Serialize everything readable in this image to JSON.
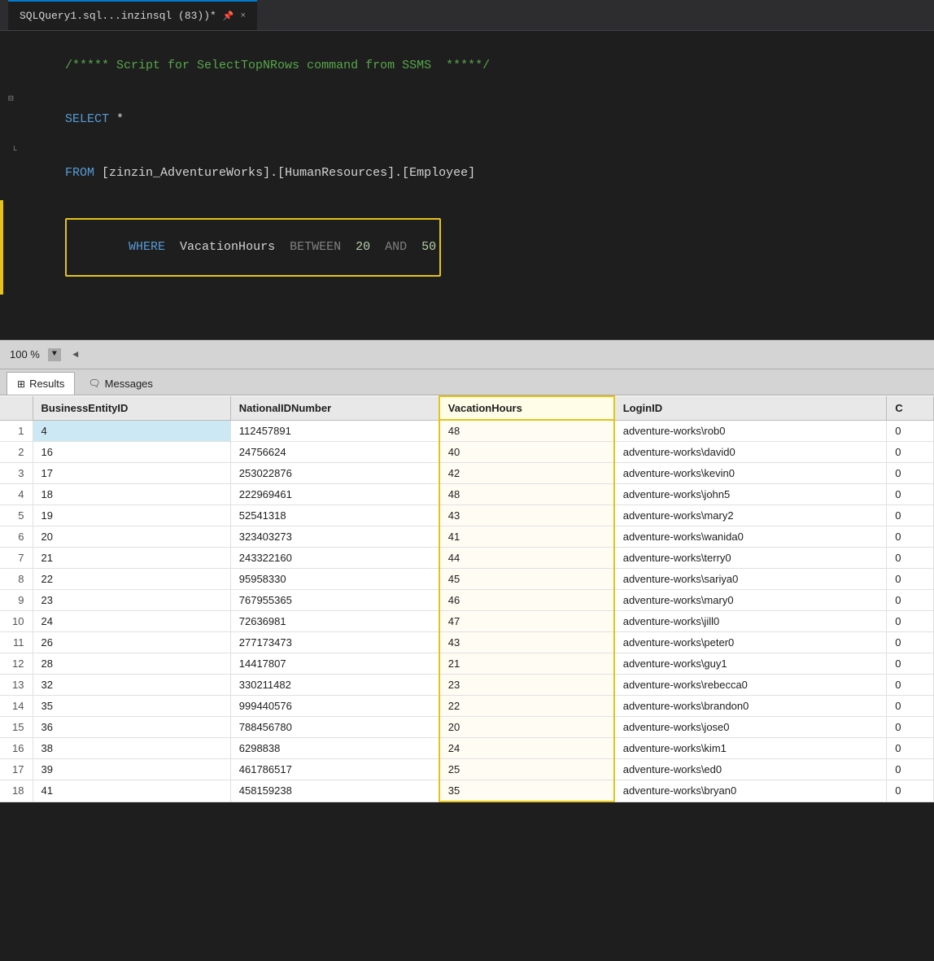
{
  "titlebar": {
    "tab_label": "SQLQuery1.sql...inzinsql (83))*",
    "pin_icon": "📌",
    "close_icon": "×"
  },
  "editor": {
    "comment_line": "/***** Script for SelectTopNRows command from SSMS  *****/",
    "select_line": "SELECT *",
    "from_line": "FROM [zinzin_AdventureWorks].[HumanResources].[Employee]",
    "where_line": "WHERE  VacationHours  BETWEEN  20  AND  50",
    "where_keyword": "WHERE",
    "where_col": "VacationHours",
    "where_between": "BETWEEN",
    "where_num1": "20",
    "where_and": "AND",
    "where_num2": "50"
  },
  "statusbar": {
    "zoom": "100 %",
    "scroll_arrow": "◄"
  },
  "results_tabs": [
    {
      "label": "Results",
      "icon": "⊞",
      "active": true
    },
    {
      "label": "Messages",
      "icon": "💬",
      "active": false
    }
  ],
  "table": {
    "columns": [
      {
        "key": "rownum",
        "label": ""
      },
      {
        "key": "BusinessEntityID",
        "label": "BusinessEntityID"
      },
      {
        "key": "NationalIDNumber",
        "label": "NationalIDNumber"
      },
      {
        "key": "VacationHours",
        "label": "VacationHours"
      },
      {
        "key": "LoginID",
        "label": "LoginID"
      },
      {
        "key": "C",
        "label": "C"
      }
    ],
    "rows": [
      {
        "rownum": "1",
        "BusinessEntityID": "4",
        "NationalIDNumber": "112457891",
        "VacationHours": "48",
        "LoginID": "adventure-works\\rob0",
        "C": "0",
        "selected": true
      },
      {
        "rownum": "2",
        "BusinessEntityID": "16",
        "NationalIDNumber": "24756624",
        "VacationHours": "40",
        "LoginID": "adventure-works\\david0",
        "C": "0"
      },
      {
        "rownum": "3",
        "BusinessEntityID": "17",
        "NationalIDNumber": "253022876",
        "VacationHours": "42",
        "LoginID": "adventure-works\\kevin0",
        "C": "0"
      },
      {
        "rownum": "4",
        "BusinessEntityID": "18",
        "NationalIDNumber": "222969461",
        "VacationHours": "48",
        "LoginID": "adventure-works\\john5",
        "C": "0"
      },
      {
        "rownum": "5",
        "BusinessEntityID": "19",
        "NationalIDNumber": "52541318",
        "VacationHours": "43",
        "LoginID": "adventure-works\\mary2",
        "C": "0"
      },
      {
        "rownum": "6",
        "BusinessEntityID": "20",
        "NationalIDNumber": "323403273",
        "VacationHours": "41",
        "LoginID": "adventure-works\\wanida0",
        "C": "0"
      },
      {
        "rownum": "7",
        "BusinessEntityID": "21",
        "NationalIDNumber": "243322160",
        "VacationHours": "44",
        "LoginID": "adventure-works\\terry0",
        "C": "0"
      },
      {
        "rownum": "8",
        "BusinessEntityID": "22",
        "NationalIDNumber": "95958330",
        "VacationHours": "45",
        "LoginID": "adventure-works\\sariya0",
        "C": "0"
      },
      {
        "rownum": "9",
        "BusinessEntityID": "23",
        "NationalIDNumber": "767955365",
        "VacationHours": "46",
        "LoginID": "adventure-works\\mary0",
        "C": "0"
      },
      {
        "rownum": "10",
        "BusinessEntityID": "24",
        "NationalIDNumber": "72636981",
        "VacationHours": "47",
        "LoginID": "adventure-works\\jill0",
        "C": "0"
      },
      {
        "rownum": "11",
        "BusinessEntityID": "26",
        "NationalIDNumber": "277173473",
        "VacationHours": "43",
        "LoginID": "adventure-works\\peter0",
        "C": "0"
      },
      {
        "rownum": "12",
        "BusinessEntityID": "28",
        "NationalIDNumber": "14417807",
        "VacationHours": "21",
        "LoginID": "adventure-works\\guy1",
        "C": "0"
      },
      {
        "rownum": "13",
        "BusinessEntityID": "32",
        "NationalIDNumber": "330211482",
        "VacationHours": "23",
        "LoginID": "adventure-works\\rebecca0",
        "C": "0"
      },
      {
        "rownum": "14",
        "BusinessEntityID": "35",
        "NationalIDNumber": "999440576",
        "VacationHours": "22",
        "LoginID": "adventure-works\\brandon0",
        "C": "0"
      },
      {
        "rownum": "15",
        "BusinessEntityID": "36",
        "NationalIDNumber": "788456780",
        "VacationHours": "20",
        "LoginID": "adventure-works\\jose0",
        "C": "0"
      },
      {
        "rownum": "16",
        "BusinessEntityID": "38",
        "NationalIDNumber": "6298838",
        "VacationHours": "24",
        "LoginID": "adventure-works\\kim1",
        "C": "0"
      },
      {
        "rownum": "17",
        "BusinessEntityID": "39",
        "NationalIDNumber": "461786517",
        "VacationHours": "25",
        "LoginID": "adventure-works\\ed0",
        "C": "0"
      },
      {
        "rownum": "18",
        "BusinessEntityID": "41",
        "NationalIDNumber": "458159238",
        "VacationHours": "35",
        "LoginID": "adventure-works\\bryan0",
        "C": "0"
      }
    ]
  }
}
